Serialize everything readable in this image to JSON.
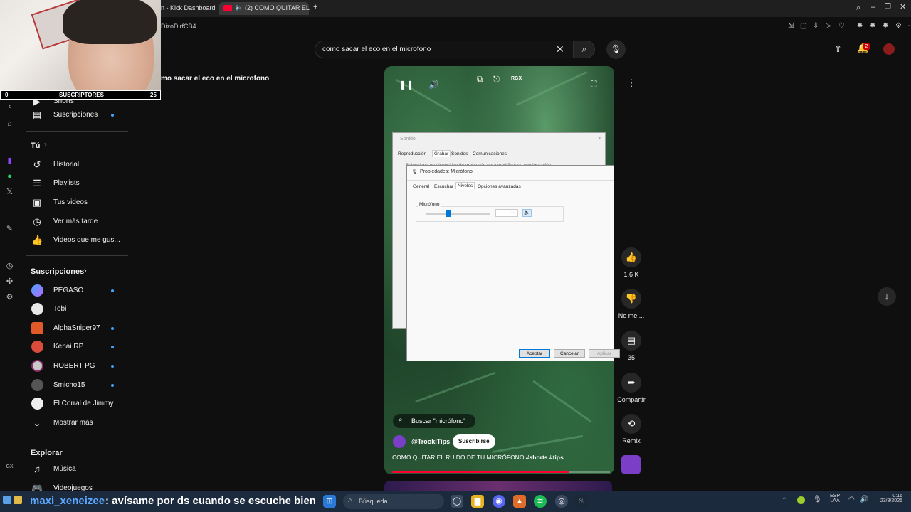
{
  "browser": {
    "tab1_title": "n - Kick Dashboard",
    "tab2_title": "(2) COMO QUITAR EL",
    "new_tab": "+",
    "url_fragment": "DizoDlrfCB4"
  },
  "webcam": {
    "subs_left": "0",
    "subs_label": "SUSCRIPTORES",
    "subs_right": "25"
  },
  "page_heading_fragment": "mo sacar el eco en el microfono",
  "search": {
    "query": "como sacar el eco en el microfono"
  },
  "header": {
    "notification_count": "2"
  },
  "sidebar": {
    "shorts": "Shorts",
    "subscriptions": "Suscripciones",
    "you": "Tú",
    "you_items": [
      "Historial",
      "Playlists",
      "Tus videos",
      "Ver más tarde",
      "Videos que me gus..."
    ],
    "subs_head": "Suscripciones",
    "channels": [
      "PEGASO",
      "Tobi",
      "AlphaSniper97",
      "Kenai RP",
      "ROBERT PG",
      "Smicho15",
      "El Corral de Jimmy"
    ],
    "show_more": "Mostrar más",
    "explore_head": "Explorar",
    "explore_items": [
      "Música",
      "Videojuegos"
    ]
  },
  "video": {
    "hd_badge": "RGX",
    "buscar_chip": "Buscar \"micrófono\"",
    "channel": "@TrookiTips",
    "subscribe": "Suscribirse",
    "title_text": "COMO QUITAR EL RUIDO DE TU MICRÓFONO ",
    "title_tags": "#shorts #tips",
    "progress": 0.81
  },
  "dialog_sound": {
    "title": "Sonido",
    "tabs": [
      "Reproducción",
      "Grabar",
      "Sonidos",
      "Comunicaciones"
    ],
    "body": "Seleccione un dispositivo de grabación para modificar su configuración:"
  },
  "dialog_mic": {
    "title": "Propiedades: Micrófono",
    "tabs": [
      "General",
      "Escuchar",
      "Niveles",
      "Opciones avanzadas"
    ],
    "group_label": "Micrófono",
    "level_value": "36",
    "level": 0.36,
    "buttons": [
      "Aceptar",
      "Cancelar",
      "Aplicar"
    ]
  },
  "actions": {
    "likes": "1.6 K",
    "dislike_label": "No me ...",
    "comments": "35",
    "share": "Compartir",
    "remix": "Remix"
  },
  "chat": {
    "user": "maxi_xeneizee",
    "message": ": avísame por ds cuando se escuche bien"
  },
  "taskbar": {
    "search_placeholder": "Búsqueda",
    "lang": "ESP",
    "lang_sub": "LAA",
    "time": "0:16",
    "date": "23/8/2025"
  },
  "colors": {
    "accent_red": "#ff0033",
    "dot_blue": "#3ea6ff",
    "chat_user": "#53fc18",
    "dialog_blue": "#0078d7"
  }
}
